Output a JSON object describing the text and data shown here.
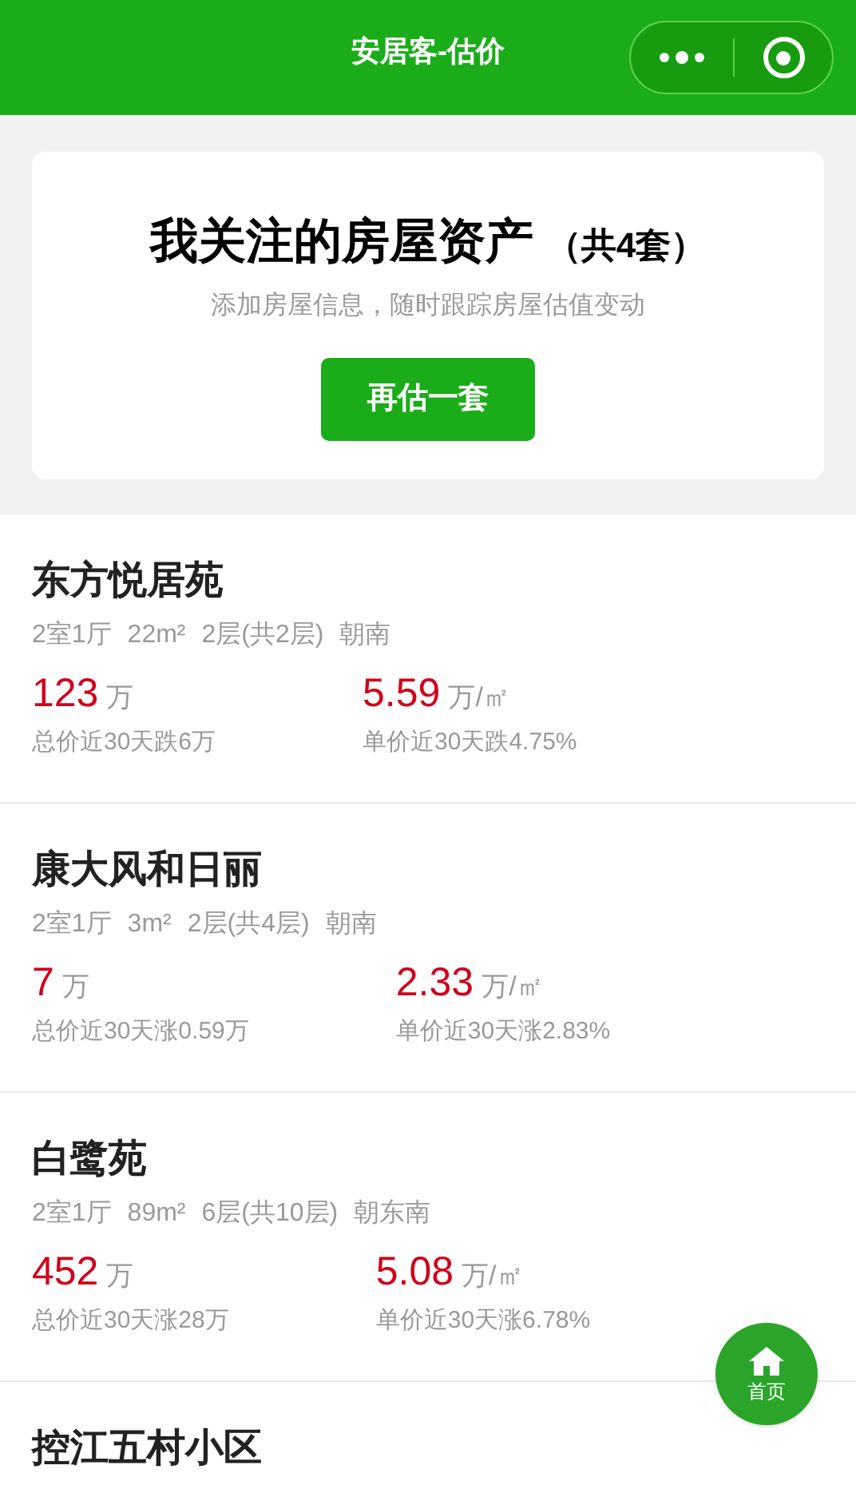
{
  "header": {
    "title": "安居客-估价"
  },
  "summary": {
    "title": "我关注的房屋资产",
    "count": "（共4套）",
    "subtitle": "添加房屋信息，随时跟踪房屋估值变动",
    "button": "再估一套"
  },
  "houses": [
    {
      "name": "东方悦居苑",
      "specs": [
        "2室1厅",
        "22m²",
        "2层(共2层)",
        "朝南"
      ],
      "total_price": "123",
      "total_unit": "万",
      "total_change": "总价近30天跌6万",
      "unit_price": "5.59",
      "unit_price_unit": "万/㎡",
      "unit_change": "单价近30天跌4.75%"
    },
    {
      "name": "康大风和日丽",
      "specs": [
        "2室1厅",
        "3m²",
        "2层(共4层)",
        "朝南"
      ],
      "total_price": "7",
      "total_unit": "万",
      "total_change": "总价近30天涨0.59万",
      "unit_price": "2.33",
      "unit_price_unit": "万/㎡",
      "unit_change": "单价近30天涨2.83%"
    },
    {
      "name": "白鹭苑",
      "specs": [
        "2室1厅",
        "89m²",
        "6层(共10层)",
        "朝东南"
      ],
      "total_price": "452",
      "total_unit": "万",
      "total_change": "总价近30天涨28万",
      "unit_price": "5.08",
      "unit_price_unit": "万/㎡",
      "unit_change": "单价近30天涨6.78%"
    },
    {
      "name": "控江五村小区"
    }
  ],
  "home_button": {
    "label": "首页"
  }
}
